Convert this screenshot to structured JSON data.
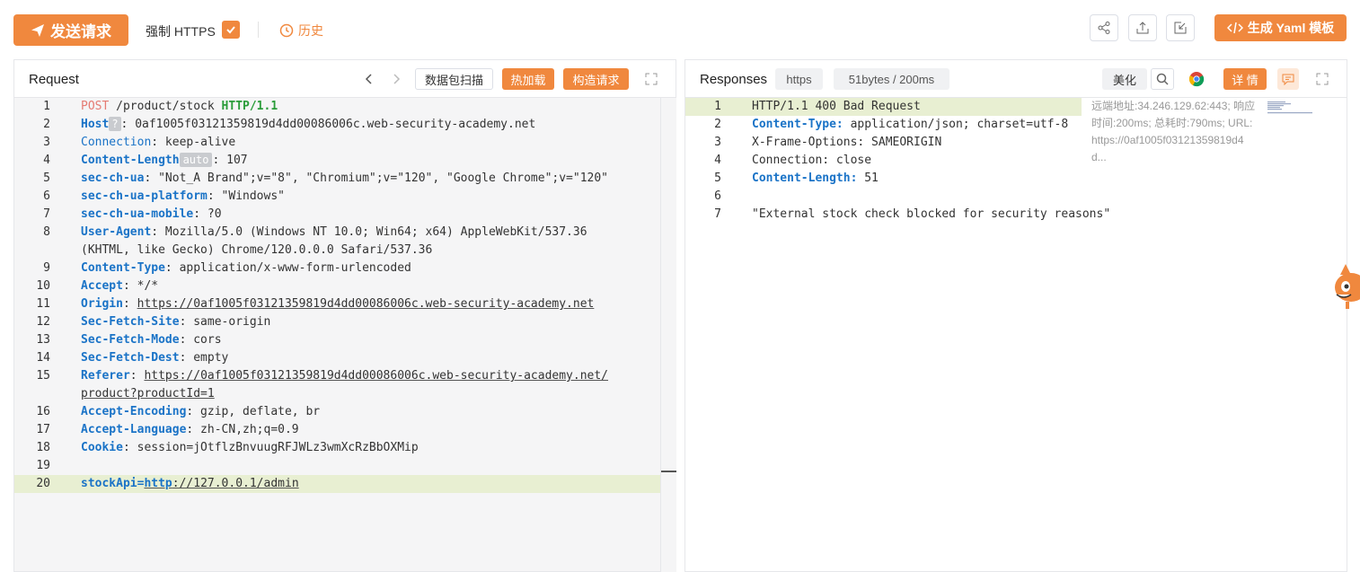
{
  "toolbar": {
    "send_label": "发送请求",
    "force_https_label": "强制 HTTPS",
    "history_label": "历史",
    "yaml_label": "生成 Yaml 模板"
  },
  "request": {
    "title": "Request",
    "scan_label": "数据包扫描",
    "hot_load_label": "热加载",
    "construct_label": "构造请求",
    "host_badge": "?",
    "length_badge": "auto",
    "lines": [
      {
        "n": "1",
        "method": "POST",
        "path": " /product/stock ",
        "proto": "HTTP/1.1"
      },
      {
        "n": "2",
        "key": "Host",
        "val": ": 0af1005f03121359819d4dd00086006c.web-security-academy.net"
      },
      {
        "n": "3",
        "key": "Connection",
        "val": ": keep-alive"
      },
      {
        "n": "4",
        "key": "Content-Length",
        "val": ": 107"
      },
      {
        "n": "5",
        "key": "sec-ch-ua",
        "val": ": \"Not_A Brand\";v=\"8\", \"Chromium\";v=\"120\", \"Google Chrome\";v=\"120\""
      },
      {
        "n": "6",
        "key": "sec-ch-ua-platform",
        "val": ": \"Windows\""
      },
      {
        "n": "7",
        "key": "sec-ch-ua-mobile",
        "val": ": ?0"
      },
      {
        "n": "8",
        "key": "User-Agent",
        "val": ": Mozilla/5.0 (Windows NT 10.0; Win64; x64) AppleWebKit/537.36",
        "cont": "(KHTML, like Gecko) Chrome/120.0.0.0 Safari/537.36"
      },
      {
        "n": "9",
        "key": "Content-Type",
        "val": ": application/x-www-form-urlencoded"
      },
      {
        "n": "10",
        "key": "Accept",
        "val": ": */*"
      },
      {
        "n": "11",
        "key": "Origin",
        "val": ": ",
        "link": "https://0af1005f03121359819d4dd00086006c.web-security-academy.net"
      },
      {
        "n": "12",
        "key": "Sec-Fetch-Site",
        "val": ": same-origin"
      },
      {
        "n": "13",
        "key": "Sec-Fetch-Mode",
        "val": ": cors"
      },
      {
        "n": "14",
        "key": "Sec-Fetch-Dest",
        "val": ": empty"
      },
      {
        "n": "15",
        "key": "Referer",
        "val": ": ",
        "link": "https://0af1005f03121359819d4dd00086006c.web-security-academy.net/",
        "cont_link": "product?productId=1"
      },
      {
        "n": "16",
        "key": "Accept-Encoding",
        "val": ": gzip, deflate, br"
      },
      {
        "n": "17",
        "key": "Accept-Language",
        "val": ": zh-CN,zh;q=0.9"
      },
      {
        "n": "18",
        "key": "Cookie",
        "val": ": session=jOtflzBnvuugRFJWLz3wmXcRzBbOXMip"
      },
      {
        "n": "19"
      },
      {
        "n": "20",
        "body_key": "stockApi=",
        "body_link1": "http",
        "body_link2": "://127.0.0.1/admin"
      }
    ]
  },
  "response": {
    "title": "Responses",
    "scheme": "https",
    "stats": "51bytes / 200ms",
    "beautify_label": "美化",
    "details_label": "详 情",
    "meta_line1": "远端地址:34.246.129.62:443; 响应",
    "meta_line2": "时间:200ms; 总耗时:790ms; URL:",
    "meta_line3": "https://0af1005f03121359819d4",
    "meta_line4": "d...",
    "lines": [
      {
        "n": "1",
        "text": "HTTP/1.1 400 Bad Request"
      },
      {
        "n": "2",
        "key": "Content-Type:",
        "val": " application/json; charset=utf-8"
      },
      {
        "n": "3",
        "text": "X-Frame-Options: SAMEORIGIN"
      },
      {
        "n": "4",
        "text": "Connection: close"
      },
      {
        "n": "5",
        "key": "Content-Length:",
        "val": " 51"
      },
      {
        "n": "6"
      },
      {
        "n": "7",
        "text": "\"External stock check blocked for security reasons\""
      }
    ]
  },
  "colors": {
    "accent": "#f0883e",
    "keyword": "#1a73c7",
    "highlight": "#e8efd2"
  },
  "icons": [
    "send-icon",
    "clock-icon",
    "share-icon",
    "export-icon",
    "import-icon",
    "code-icon",
    "chevron-left-icon",
    "chevron-right-icon",
    "expand-icon",
    "search-icon",
    "chrome-icon",
    "comment-icon",
    "mascot-icon"
  ]
}
